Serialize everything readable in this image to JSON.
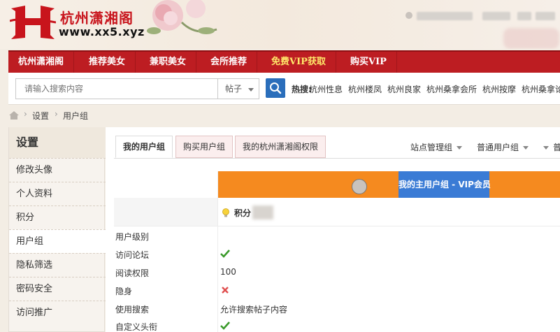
{
  "header": {
    "logo_letter": "H",
    "site_title": "杭州潇湘阁",
    "site_url": "www.xx5.xyz"
  },
  "nav": {
    "items": [
      "杭州潇湘阁",
      "推荐美女",
      "兼职美女",
      "会所推荐",
      "免费VIP获取",
      "购买VIP"
    ]
  },
  "search": {
    "placeholder": "请输入搜索内容",
    "scope": "帖子",
    "hot_label": "热搜:",
    "hot_links": [
      "杭州性息",
      "杭州楼凤",
      "杭州良家",
      "杭州桑拿会所",
      "杭州按摩",
      "杭州桑拿论"
    ]
  },
  "breadcrumb": {
    "items": [
      "设置",
      "用户组"
    ]
  },
  "sidebar": {
    "title": "设置",
    "items": [
      "修改头像",
      "个人资料",
      "积分",
      "用户组",
      "隐私筛选",
      "密码安全",
      "访问推广"
    ],
    "active_index": 3
  },
  "tabs": {
    "items": [
      "我的用户组",
      "购买用户组",
      "我的杭州潇湘阁权限"
    ],
    "right_items": [
      "站点管理组",
      "普通用户组",
      "普通"
    ]
  },
  "group": {
    "main_label": "我的主用户组 - VIP会员",
    "points_label": "积分"
  },
  "rows": [
    {
      "label": "用户级别",
      "value": ""
    },
    {
      "label": "访问论坛",
      "value": "",
      "status": "yes"
    },
    {
      "label": "阅读权限",
      "value": "100"
    },
    {
      "label": "隐身",
      "value": "",
      "status": "no"
    },
    {
      "label": "使用搜索",
      "value": "允许搜索帖子内容"
    },
    {
      "label": "自定义头衔",
      "value": "",
      "status": "yes"
    }
  ],
  "colors": {
    "nav_red": "#bd1d22",
    "vip_yellow": "#ffe86a",
    "orange_band": "#f58a1f",
    "blue_cell": "#3a7bd5",
    "ok_green": "#3a9a2a",
    "no_red": "#e05050"
  }
}
